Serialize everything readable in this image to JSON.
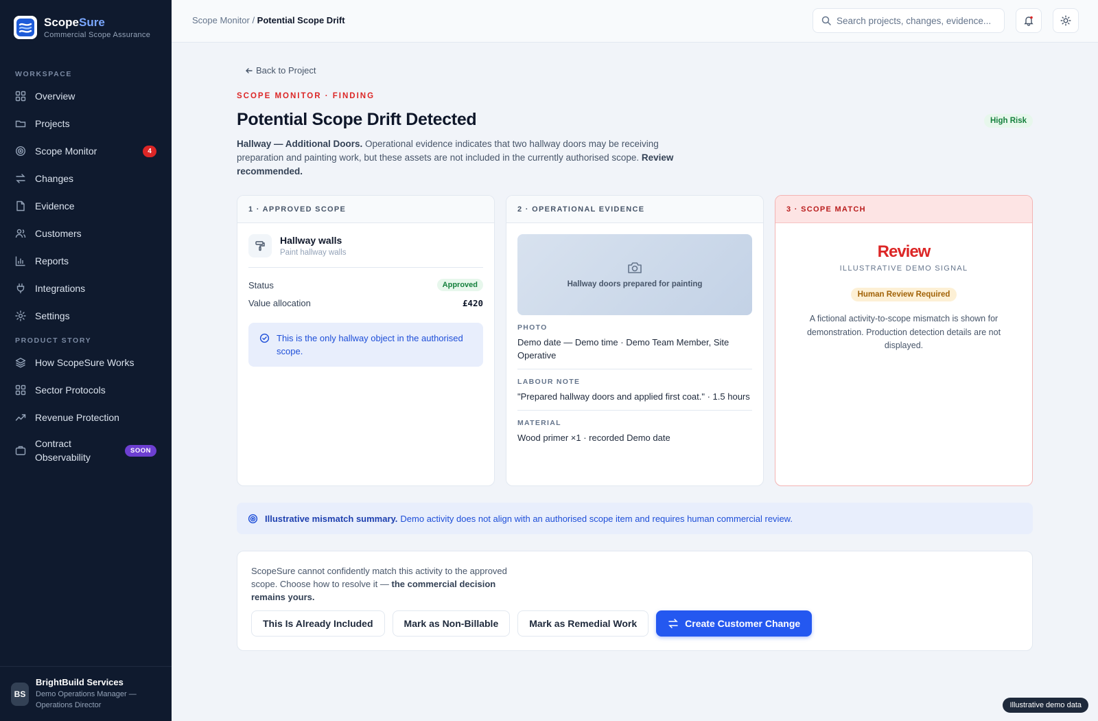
{
  "brand": {
    "name_part1": "Scope",
    "name_part2": "Sure",
    "tagline": "Commercial Scope Assurance"
  },
  "sidebar": {
    "workspace_label": "WORKSPACE",
    "workspace_items": [
      {
        "label": "Overview",
        "icon": "grid-icon"
      },
      {
        "label": "Projects",
        "icon": "folder-icon"
      },
      {
        "label": "Scope Monitor",
        "icon": "target-icon",
        "badge": "4"
      },
      {
        "label": "Changes",
        "icon": "arrows-swap-icon"
      },
      {
        "label": "Evidence",
        "icon": "file-icon"
      },
      {
        "label": "Customers",
        "icon": "users-icon"
      },
      {
        "label": "Reports",
        "icon": "bar-chart-icon"
      },
      {
        "label": "Integrations",
        "icon": "plug-icon"
      },
      {
        "label": "Settings",
        "icon": "gear-icon"
      }
    ],
    "product_label": "PRODUCT STORY",
    "product_items": [
      {
        "label": "How ScopeSure Works",
        "icon": "layers-icon"
      },
      {
        "label": "Sector Protocols",
        "icon": "grid-icon"
      },
      {
        "label": "Revenue Protection",
        "icon": "trend-icon"
      },
      {
        "label": "Contract Observability",
        "icon": "briefcase-icon",
        "badge": "SOON"
      }
    ],
    "user": {
      "initials": "BS",
      "name": "BrightBuild Services",
      "role": "Demo Operations Manager — Operations Director"
    }
  },
  "topbar": {
    "breadcrumb_parent": "Scope Monitor",
    "breadcrumb_sep": " / ",
    "breadcrumb_current": "Potential Scope Drift",
    "search_placeholder": "Search projects, changes, evidence..."
  },
  "page": {
    "back_label": "Back to Project",
    "eyebrow": "SCOPE MONITOR · FINDING",
    "title": "Potential Scope Drift Detected",
    "risk_badge": "High Risk",
    "intro_lead": "Hallway — Additional Doors.",
    "intro_body": " Operational evidence indicates that two hallway doors may be receiving preparation and painting work, but these assets are not included in the currently authorised scope. ",
    "intro_tail": "Review recommended."
  },
  "approved_scope": {
    "header": "1 · APPROVED SCOPE",
    "item_title": "Hallway walls",
    "item_subtitle": "Paint hallway walls",
    "status_label": "Status",
    "status_value": "Approved",
    "value_label": "Value allocation",
    "value_amount": "£420",
    "note": "This is the only hallway object in the authorised scope."
  },
  "operational_evidence": {
    "header": "2 · OPERATIONAL EVIDENCE",
    "photo_caption": "Hallway doors prepared for painting",
    "photo_label": "PHOTO",
    "photo_value": "Demo date — Demo time · Demo Team Member, Site Operative",
    "labour_label": "LABOUR NOTE",
    "labour_value": "\"Prepared hallway doors and applied first coat.\" · 1.5 hours",
    "material_label": "MATERIAL",
    "material_value": "Wood primer ×1 · recorded Demo date"
  },
  "scope_match": {
    "header": "3 · SCOPE MATCH",
    "verdict": "Review",
    "verdict_sub": "ILLUSTRATIVE DEMO SIGNAL",
    "review_badge": "Human Review Required",
    "note": "A fictional activity-to-scope mismatch is shown for demonstration. Production detection details are not displayed."
  },
  "summary": {
    "lead": "Illustrative mismatch summary.",
    "body": "Demo activity does not align with an authorised scope item and requires human commercial review."
  },
  "decision": {
    "text_body": "ScopeSure cannot confidently match this activity to the approved scope. Choose how to resolve it — ",
    "text_bold": "the commercial decision remains yours.",
    "buttons": {
      "already_included": "This Is Already Included",
      "non_billable": "Mark as Non-Billable",
      "remedial": "Mark as Remedial Work",
      "create_change": "Create Customer Change"
    }
  },
  "footer_chip": "Illustrative demo data",
  "colors": {
    "sidebar_bg": "#0f1a2e",
    "accent_blue": "#2458f0",
    "danger_red": "#dc2626",
    "success_green": "#15803d",
    "warning_amber": "#a16207"
  }
}
